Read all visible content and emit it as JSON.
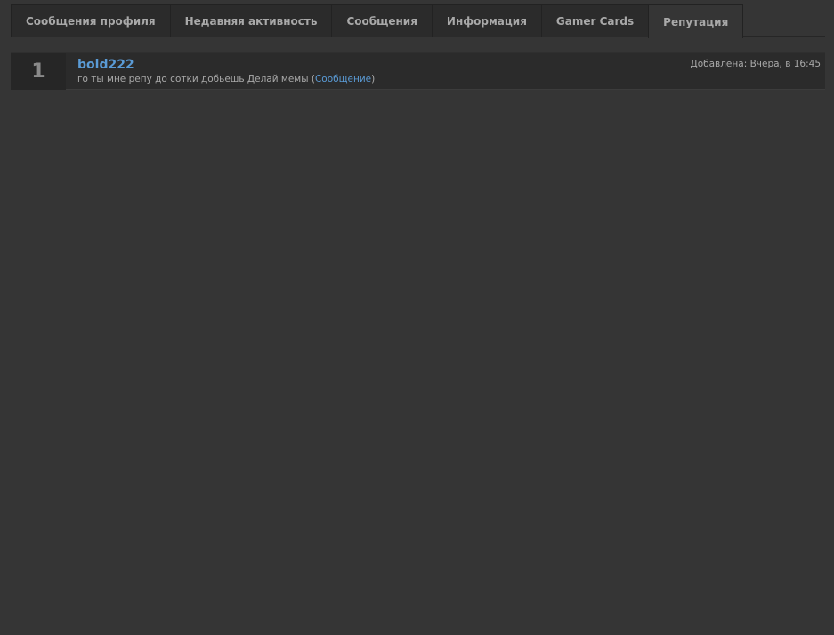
{
  "tabs": [
    {
      "label": "Сообщения профиля"
    },
    {
      "label": "Недавняя активность"
    },
    {
      "label": "Сообщения"
    },
    {
      "label": "Информация"
    },
    {
      "label": "Gamer Cards"
    },
    {
      "label": "Репутация",
      "active": true
    }
  ],
  "reputation": {
    "items": [
      {
        "rank": "1",
        "user": "bold222",
        "comment": "го ты мне репу до сотки добьешь Делай мемы",
        "open_paren": "(",
        "link_label": "Сообщение",
        "close_paren": ")",
        "date": "Добавлена: Вчера, в 16:45"
      }
    ]
  },
  "colors": {
    "background": "#353535",
    "tab_bg": "#2b2b2b",
    "link": "#5a9bd6",
    "text": "#a9a9a9"
  }
}
